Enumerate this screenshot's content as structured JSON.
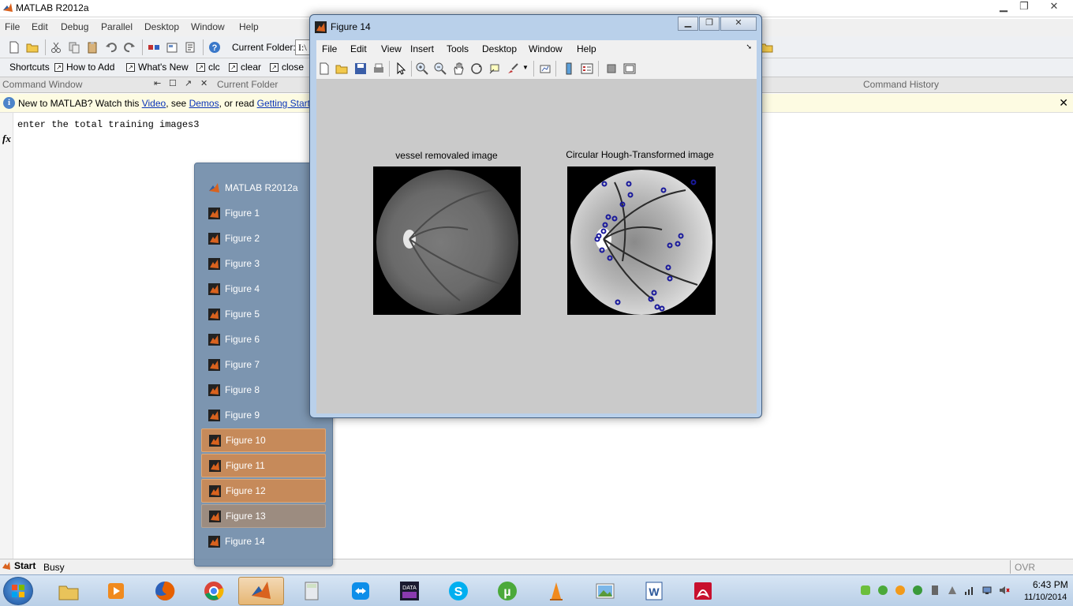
{
  "main": {
    "title": "MATLAB  R2012a",
    "menu": [
      "File",
      "Edit",
      "Debug",
      "Parallel",
      "Desktop",
      "Window",
      "Help"
    ],
    "current_folder_label": "Current Folder:",
    "current_folder_value": "I:\\",
    "shortcuts_label": "Shortcuts",
    "shortcuts": [
      "How to Add",
      "What's New",
      "clc",
      "clear",
      "close"
    ],
    "panels": {
      "command_window": "Command Window",
      "current_folder": "Current Folder",
      "command_history": "Command History"
    },
    "info": {
      "prefix": "New to MATLAB? Watch this ",
      "video": "Video",
      "mid1": ", see ",
      "demos": "Demos",
      "mid2": ", or read ",
      "getting_started": "Getting Starte"
    },
    "command_output": "enter the total training images3",
    "status": {
      "start": "Start",
      "busy": "Busy",
      "ovr": "OVR"
    }
  },
  "figure": {
    "title": "Figure 14",
    "menu": [
      "File",
      "Edit",
      "View",
      "Insert",
      "Tools",
      "Desktop",
      "Window",
      "Help"
    ],
    "plot1_title": "vessel removaled image",
    "plot2_title": "Circular Hough-Transformed image"
  },
  "jumplist": {
    "header": "MATLAB  R2012a",
    "items": [
      "Figure 1",
      "Figure 2",
      "Figure 3",
      "Figure 4",
      "Figure 5",
      "Figure 6",
      "Figure 7",
      "Figure 8",
      "Figure 9",
      "Figure 10",
      "Figure 11",
      "Figure 12",
      "Figure 13",
      "Figure 14"
    ]
  },
  "taskbar": {
    "time": "6:43 PM",
    "date": "11/10/2014",
    "apps": [
      "explorer-icon",
      "media-player-icon",
      "firefox-icon",
      "chrome-icon",
      "matlab-icon",
      "calculator-icon",
      "teamviewer-icon",
      "data-app-icon",
      "skype-icon",
      "utorrent-icon",
      "vlc-icon",
      "picture-viewer-icon",
      "word-icon",
      "acrobat-icon"
    ]
  },
  "colors": {
    "jumplist_bg": "#728daa",
    "active_item": "#c68a5a",
    "info_bar": "#fdfbe2",
    "link": "#0a34b8",
    "circle_marker": "#1a1a9c"
  }
}
